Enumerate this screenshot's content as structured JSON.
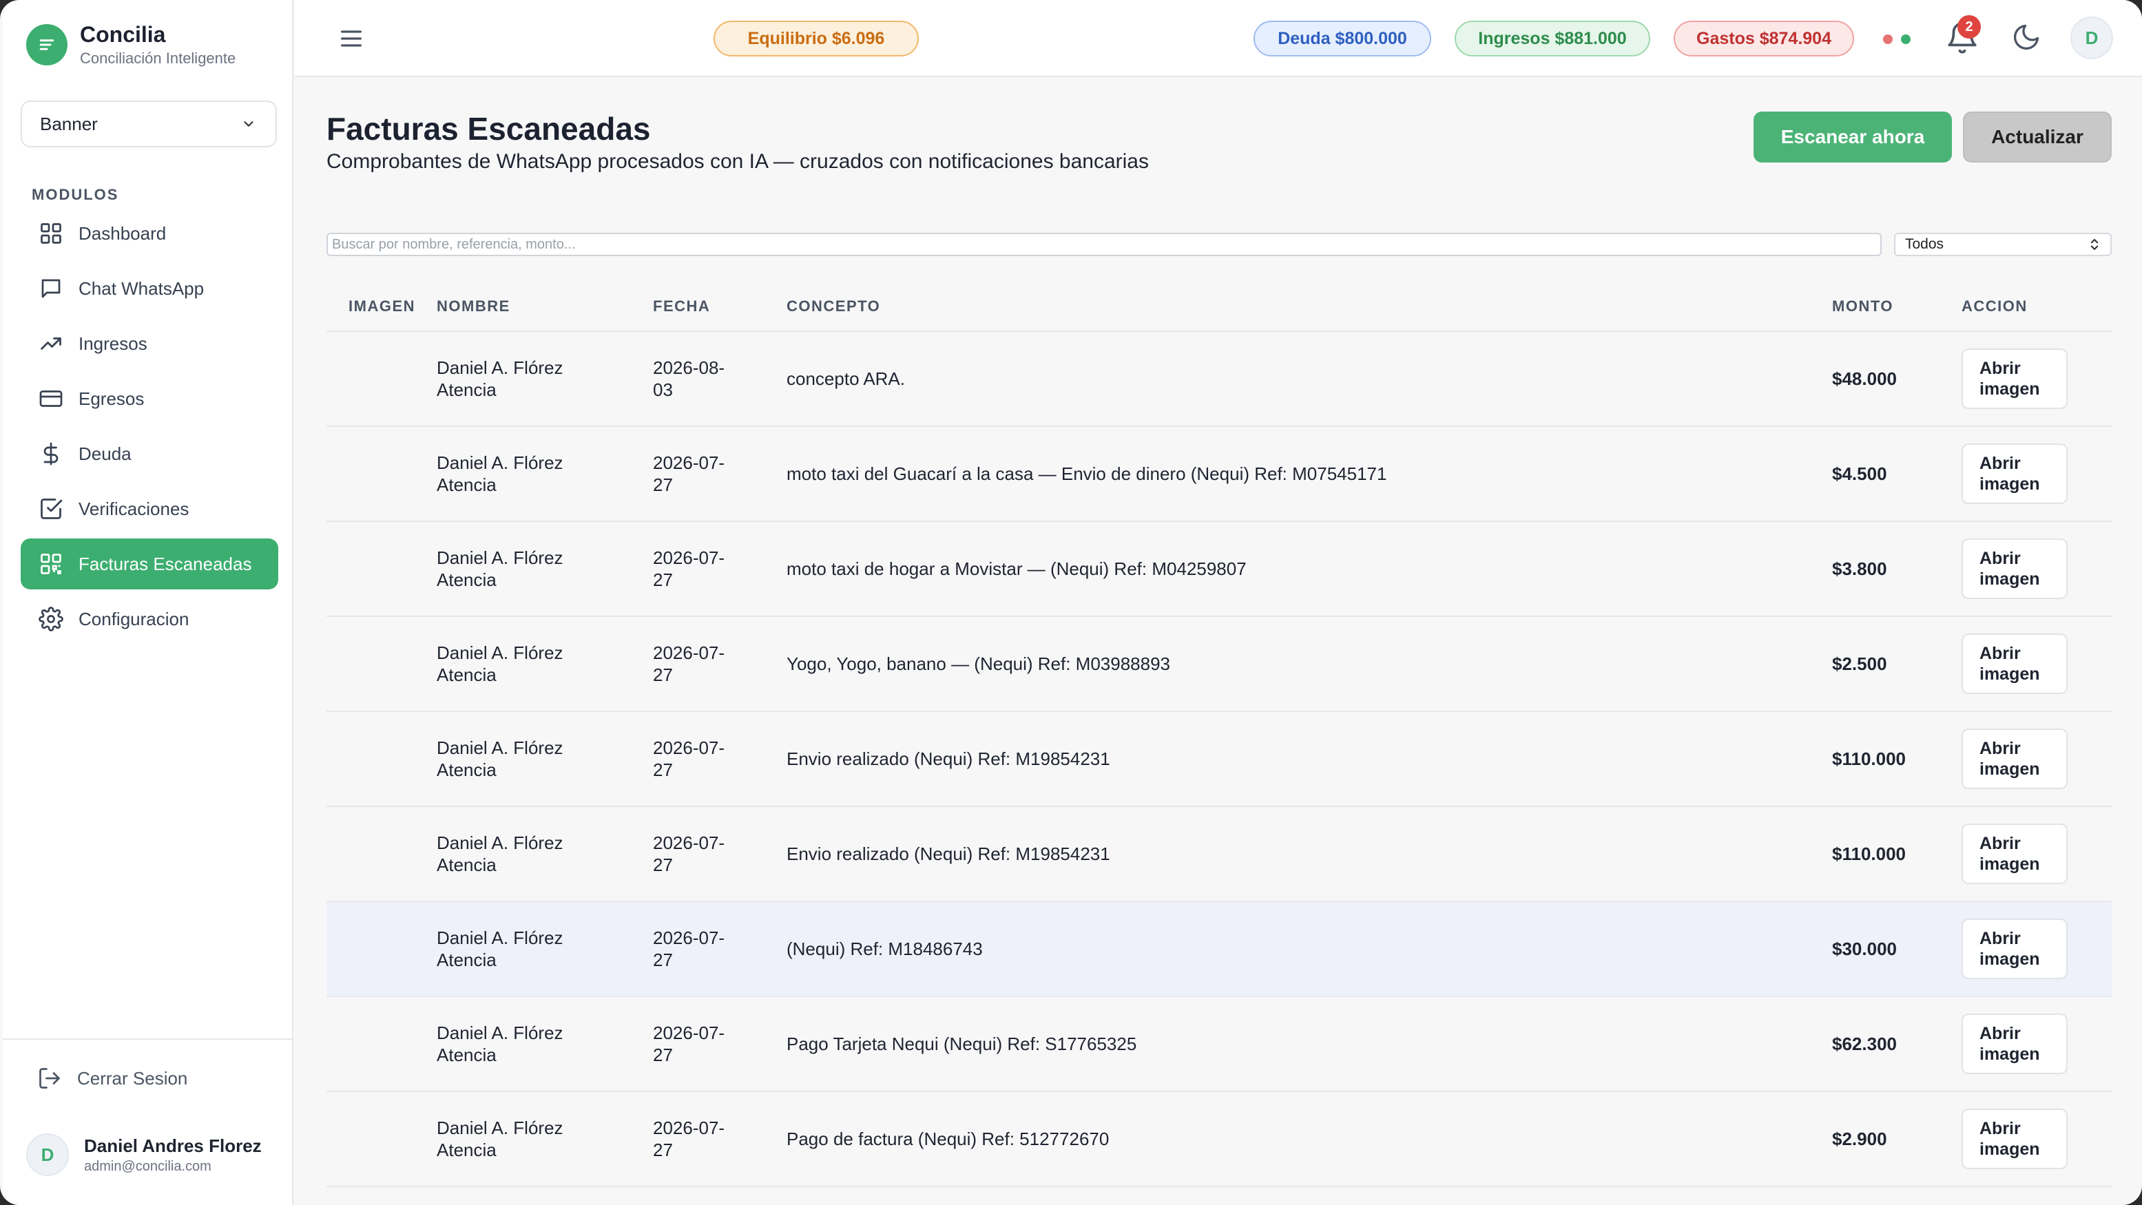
{
  "brand": {
    "name": "Concilia",
    "subtitle": "Conciliación Inteligente"
  },
  "project_select": {
    "value": "Banner"
  },
  "sidebar": {
    "section_label": "MODULOS",
    "items": [
      {
        "label": "Dashboard",
        "icon": "grid-icon"
      },
      {
        "label": "Chat WhatsApp",
        "icon": "chat-icon"
      },
      {
        "label": "Ingresos",
        "icon": "trend-up-icon"
      },
      {
        "label": "Egresos",
        "icon": "card-icon"
      },
      {
        "label": "Deuda",
        "icon": "dollar-icon"
      },
      {
        "label": "Verificaciones",
        "icon": "check-square-icon"
      },
      {
        "label": "Facturas Escaneadas",
        "icon": "qr-icon",
        "active": true
      },
      {
        "label": "Configuracion",
        "icon": "gear-icon"
      }
    ],
    "logout_label": "Cerrar Sesion",
    "user": {
      "initial": "D",
      "name": "Daniel Andres Florez",
      "email": "admin@concilia.com"
    }
  },
  "header": {
    "equilibrio": "Equilibrio $6.096",
    "deuda": "Deuda $800.000",
    "ingresos": "Ingresos $881.000",
    "gastos": "Gastos $874.904",
    "notifications_count": "2",
    "avatar_initial": "D",
    "status_dot_colors": [
      "#e57373",
      "#3cae6f"
    ]
  },
  "colors": {
    "accent": "#3cae6f",
    "highlight_row": "#eef1fa"
  },
  "main": {
    "title": "Facturas Escaneadas",
    "subtitle": "Comprobantes de WhatsApp procesados con IA — cruzados con notificaciones bancarias",
    "scan_button": "Escanear ahora",
    "refresh_button": "Actualizar",
    "search_placeholder": "Buscar por nombre, referencia, monto...",
    "filter_value": "Todos",
    "columns": {
      "image": "IMAGEN",
      "name": "NOMBRE",
      "date": "FECHA",
      "concept": "CONCEPTO",
      "amount": "MONTO",
      "action": "ACCION"
    },
    "rows": [
      {
        "name_1": "Daniel A. Flórez",
        "name_2": "Atencia",
        "date_1": "2026-08-",
        "date_2": "03",
        "concept": "concepto ARA.",
        "amount": "$48.000",
        "action_1": "Abrir",
        "action_2": "imagen"
      },
      {
        "name_1": "Daniel A. Flórez",
        "name_2": "Atencia",
        "date_1": "2026-07-",
        "date_2": "27",
        "concept": "moto taxi del Guacarí a la casa — Envio de dinero (Nequi) Ref: M07545171",
        "amount": "$4.500",
        "action_1": "Abrir",
        "action_2": "imagen"
      },
      {
        "name_1": "Daniel A. Flórez",
        "name_2": "Atencia",
        "date_1": "2026-07-",
        "date_2": "27",
        "concept": "moto taxi de hogar a Movistar — (Nequi) Ref: M04259807",
        "amount": "$3.800",
        "action_1": "Abrir",
        "action_2": "imagen"
      },
      {
        "name_1": "Daniel A. Flórez",
        "name_2": "Atencia",
        "date_1": "2026-07-",
        "date_2": "27",
        "concept": "Yogo, Yogo, banano — (Nequi) Ref: M03988893",
        "amount": "$2.500",
        "action_1": "Abrir",
        "action_2": "imagen"
      },
      {
        "name_1": "Daniel A. Flórez",
        "name_2": "Atencia",
        "date_1": "2026-07-",
        "date_2": "27",
        "concept": "Envio realizado (Nequi) Ref: M19854231",
        "amount": "$110.000",
        "action_1": "Abrir",
        "action_2": "imagen"
      },
      {
        "name_1": "Daniel A. Flórez",
        "name_2": "Atencia",
        "date_1": "2026-07-",
        "date_2": "27",
        "concept": "Envio realizado (Nequi) Ref: M19854231",
        "amount": "$110.000",
        "action_1": "Abrir",
        "action_2": "imagen"
      },
      {
        "name_1": "Daniel A. Flórez",
        "name_2": "Atencia",
        "date_1": "2026-07-",
        "date_2": "27",
        "concept": "(Nequi) Ref: M18486743",
        "amount": "$30.000",
        "action_1": "Abrir",
        "action_2": "imagen",
        "highlighted": true
      },
      {
        "name_1": "Daniel A. Flórez",
        "name_2": "Atencia",
        "date_1": "2026-07-",
        "date_2": "27",
        "concept": "Pago Tarjeta Nequi (Nequi) Ref: S17765325",
        "amount": "$62.300",
        "action_1": "Abrir",
        "action_2": "imagen"
      },
      {
        "name_1": "Daniel A. Flórez",
        "name_2": "Atencia",
        "date_1": "2026-07-",
        "date_2": "27",
        "concept": "Pago de factura (Nequi) Ref: 512772670",
        "amount": "$2.900",
        "action_1": "Abrir",
        "action_2": "imagen"
      }
    ]
  }
}
